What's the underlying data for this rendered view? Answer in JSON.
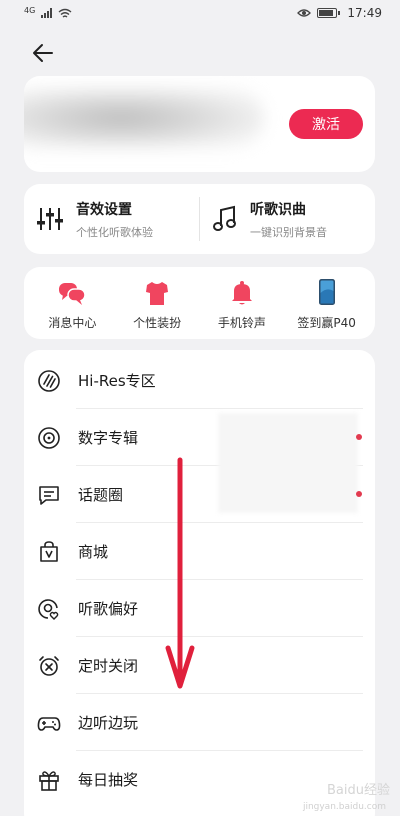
{
  "status_bar": {
    "network": "4G",
    "time": "17:49"
  },
  "vip": {
    "activate_label": "激活"
  },
  "quick": [
    {
      "title": "音效设置",
      "subtitle": "个性化听歌体验",
      "icon": "equalizer-icon"
    },
    {
      "title": "听歌识曲",
      "subtitle": "一键识别背景音",
      "icon": "music-note-icon"
    }
  ],
  "tools": [
    {
      "label": "消息中心",
      "icon": "message-center-icon"
    },
    {
      "label": "个性装扮",
      "icon": "tshirt-icon"
    },
    {
      "label": "手机铃声",
      "icon": "bell-icon"
    },
    {
      "label": "签到赢P40",
      "icon": "phone-icon"
    }
  ],
  "menu": [
    {
      "label": "Hi-Res专区",
      "icon": "hires-icon"
    },
    {
      "label": "数字专辑",
      "icon": "vinyl-icon"
    },
    {
      "label": "话题圈",
      "icon": "chat-bubble-icon"
    },
    {
      "label": "商城",
      "icon": "shopping-bag-icon"
    },
    {
      "label": "听歌偏好",
      "icon": "preference-icon"
    },
    {
      "label": "定时关闭",
      "icon": "alarm-clock-icon"
    },
    {
      "label": "边听边玩",
      "icon": "gamepad-icon"
    },
    {
      "label": "每日抽奖",
      "icon": "gift-icon"
    }
  ],
  "watermark": {
    "text": "Baidu经验",
    "sub": "jingyan.baidu.com"
  },
  "colors": {
    "accent": "#ec2a52",
    "tool_icon": "#f0455f",
    "background": "#f1f1f3",
    "arrow": "#e0203c"
  }
}
